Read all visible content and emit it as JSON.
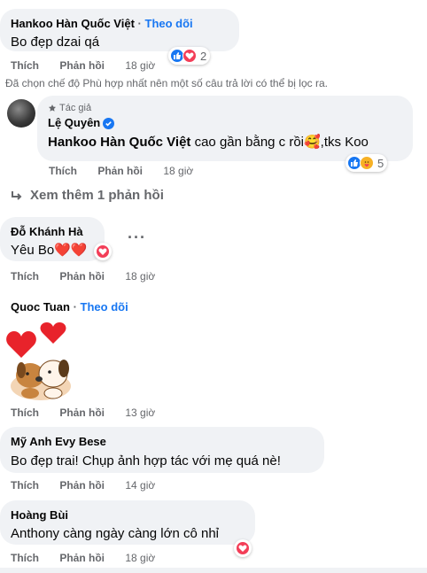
{
  "comments": [
    {
      "name": "Hankoo Hàn Quốc Việt",
      "follow": "Theo dõi",
      "text": "Bo đẹp dzai qá",
      "actions": {
        "like": "Thích",
        "reply": "Phản hồi",
        "time": "18 giờ"
      },
      "reaction_count": "2"
    },
    {
      "filter_note": "Đã chọn chế độ Phù hợp nhất nên một số câu trả lời có thể bị lọc ra.",
      "author_tag": "Tác giả",
      "name": "Lệ Quyên",
      "mention": "Hankoo Hàn Quốc Việt",
      "text": " cao gần bằng c rồi🥰,tks Koo",
      "actions": {
        "like": "Thích",
        "reply": "Phản hồi",
        "time": "18 giờ"
      },
      "reaction_count": "5"
    },
    {
      "more_replies": "Xem thêm 1 phản hồi"
    },
    {
      "name": "Đỗ Khánh Hà",
      "text": "Yêu Bo❤️❤️",
      "actions": {
        "like": "Thích",
        "reply": "Phản hồi",
        "time": "18 giờ"
      }
    },
    {
      "name": "Quoc Tuan",
      "follow": "Theo dõi",
      "actions": {
        "like": "Thích",
        "reply": "Phản hồi",
        "time": "13 giờ"
      }
    },
    {
      "name": "Mỹ Anh Evy Bese",
      "text": "Bo đẹp trai! Chụp ảnh hợp tác với mẹ quá nè!",
      "actions": {
        "like": "Thích",
        "reply": "Phản hồi",
        "time": "14 giờ"
      }
    },
    {
      "name": "Hoàng Bùi",
      "text": "Anthony càng ngày càng lớn cô nhỉ",
      "actions": {
        "like": "Thích",
        "reply": "Phản hồi",
        "time": "18 giờ"
      }
    }
  ],
  "icons": {
    "like": "thumbs-up-icon",
    "love": "heart-icon",
    "care": "care-icon",
    "verified": "verified-icon",
    "reply_arrow": "reply-arrow-icon",
    "more": "more-options-icon"
  },
  "colors": {
    "link": "#1877f2",
    "bubble": "#f0f2f5",
    "muted": "#65676b",
    "love": "#f33e58"
  }
}
